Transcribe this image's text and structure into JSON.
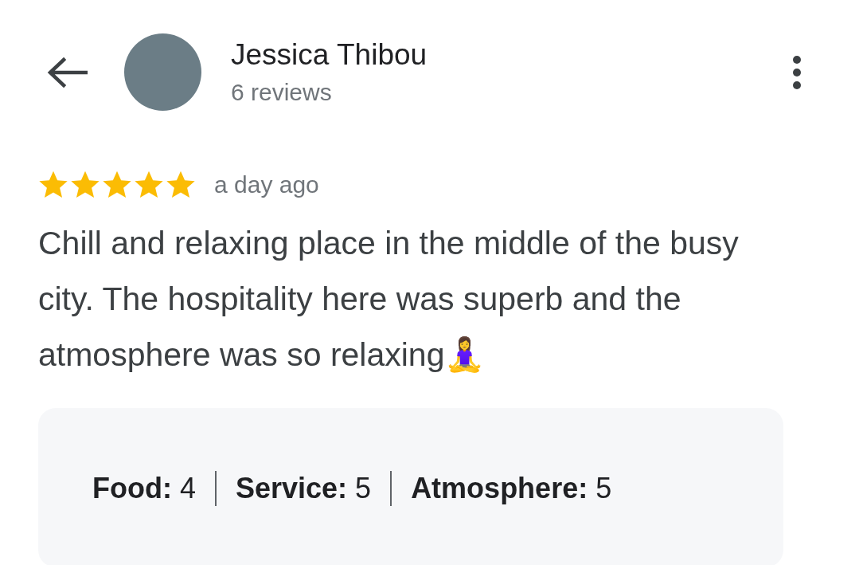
{
  "reviewer": {
    "name": "Jessica Thibou",
    "reviews_count": "6 reviews"
  },
  "review": {
    "stars": 5,
    "time": "a day ago",
    "text": "Chill and relaxing place in the middle of the busy city. The hospitality here was superb and the atmosphere was so relaxing🧘‍♀️"
  },
  "ratings": [
    "**Food:** 4",
    "**Service:** 5",
    "**Atmosphere:** 5"
  ]
}
